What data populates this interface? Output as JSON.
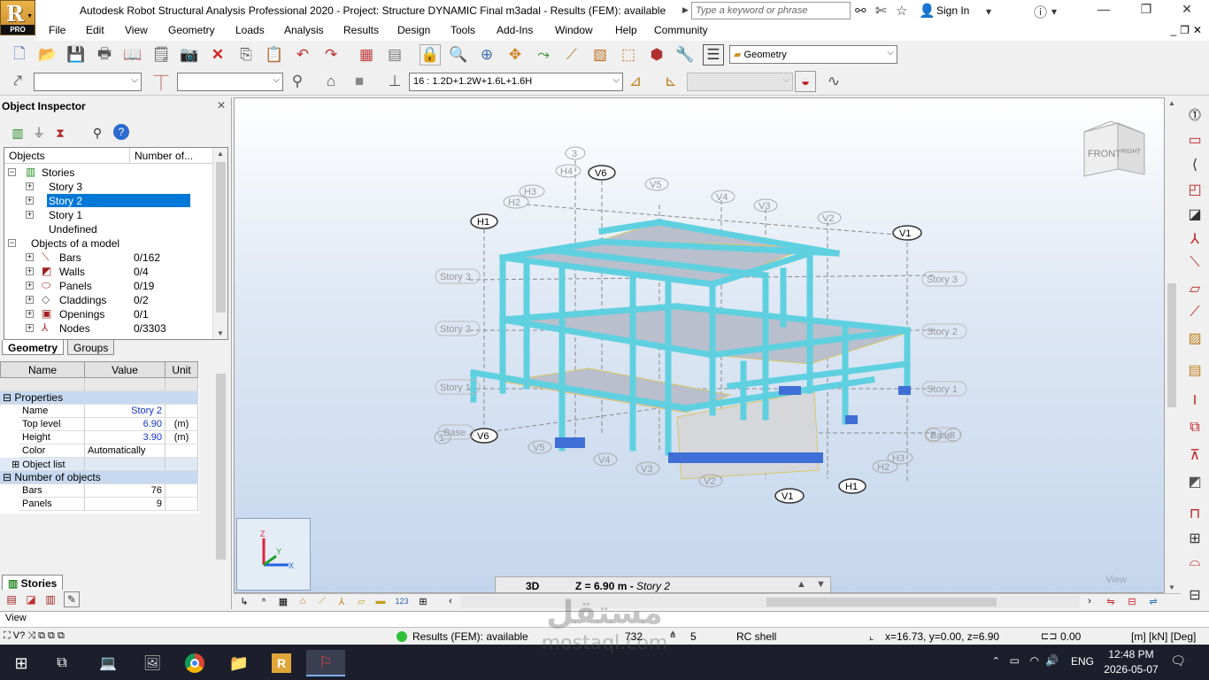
{
  "titlebar": {
    "title": "Autodesk Robot Structural Analysis Professional 2020 - Project: Structure DYNAMIC Final m3adal - Results (FEM): available",
    "search_placeholder": "Type a keyword or phrase",
    "sign_in": "Sign In",
    "logo_letter": "R",
    "logo_badge": "PRO"
  },
  "menu": [
    "File",
    "Edit",
    "View",
    "Geometry",
    "Loads",
    "Analysis",
    "Results",
    "Design",
    "Tools",
    "Add-Ins",
    "Window",
    "Help",
    "Community"
  ],
  "toolbar": {
    "layout_combo": "Geometry",
    "load_case_combo": "16 : 1.2D+1.2W+1.6L+1.6H"
  },
  "inspector": {
    "title": "Object Inspector",
    "tree_headers": [
      "Objects",
      "Number of..."
    ],
    "tree": [
      {
        "label": "Stories",
        "count": "",
        "level": 0,
        "expand": "-"
      },
      {
        "label": "Story 3",
        "count": "",
        "level": 1,
        "expand": "+"
      },
      {
        "label": "Story 2",
        "count": "",
        "level": 1,
        "expand": "+",
        "selected": true
      },
      {
        "label": "Story 1",
        "count": "",
        "level": 1,
        "expand": "+"
      },
      {
        "label": "Undefined",
        "count": "",
        "level": 1,
        "expand": ""
      },
      {
        "label": "Objects of a model",
        "count": "",
        "level": 0,
        "expand": "-"
      },
      {
        "label": "Bars",
        "count": "0/162",
        "level": 1,
        "expand": "+"
      },
      {
        "label": "Walls",
        "count": "0/4",
        "level": 1,
        "expand": "+"
      },
      {
        "label": "Panels",
        "count": "0/19",
        "level": 1,
        "expand": "+"
      },
      {
        "label": "Claddings",
        "count": "0/2",
        "level": 1,
        "expand": "+"
      },
      {
        "label": "Openings",
        "count": "0/1",
        "level": 1,
        "expand": "+"
      },
      {
        "label": "Nodes",
        "count": "0/3303",
        "level": 1,
        "expand": "+"
      }
    ],
    "tabs": [
      "Geometry",
      "Groups"
    ],
    "prop_headers": [
      "Name",
      "Value",
      "Unit"
    ],
    "props": {
      "section_properties": "Properties",
      "name_label": "Name",
      "name_value": "Story 2",
      "top_label": "Top level",
      "top_value": "6.90",
      "top_unit": "(m)",
      "height_label": "Height",
      "height_value": "3.90",
      "height_unit": "(m)",
      "color_label": "Color",
      "color_value": "Automatically",
      "objlist_label": "Object list",
      "section_objects": "Number of objects",
      "bars_label": "Bars",
      "bars_value": "76",
      "panels_label": "Panels",
      "panels_value": "9"
    },
    "bottom_tab": "Stories"
  },
  "viewport": {
    "view_mode": "3D",
    "z_text": "Z = 6.90 m - ",
    "z_story": "Story 2",
    "view_label": "View",
    "cube_front": "FRONT",
    "cube_right": "RIGHT",
    "axis_labels": [
      "Z",
      "Y",
      "X"
    ],
    "story_labels": [
      "Story 3",
      "Story 2",
      "Story 1",
      "Base"
    ],
    "story_labels_right": [
      "Story 3",
      "Story 2",
      "Story 1",
      "Base"
    ],
    "grid_labels": [
      "3",
      "H4",
      "V6",
      "H3",
      "H2",
      "H1",
      "V5",
      "V4",
      "V3",
      "V2",
      "V1",
      "V6",
      "V5",
      "V4",
      "V3",
      "V2",
      "V1",
      "H1",
      "H2",
      "H3",
      "1",
      "2",
      "3"
    ]
  },
  "command_line": {
    "value": "View"
  },
  "status": {
    "results": "Results (FEM): available",
    "nodes": "732",
    "cases": "5",
    "section": "RC shell",
    "coords": "x=16.73, y=0.00, z=6.90",
    "angle": "0.00",
    "units": "[m] [kN] [Deg]"
  },
  "taskbar": {
    "lang": "ENG",
    "time": "12:48 PM",
    "date": "2026-05-07"
  },
  "watermark": {
    "arabic": "مستقل",
    "latin": "mostaql.com"
  },
  "colors": {
    "structure": "#5fd0e0",
    "selection": "#0078d7",
    "section_row": "#c6d9f1"
  }
}
